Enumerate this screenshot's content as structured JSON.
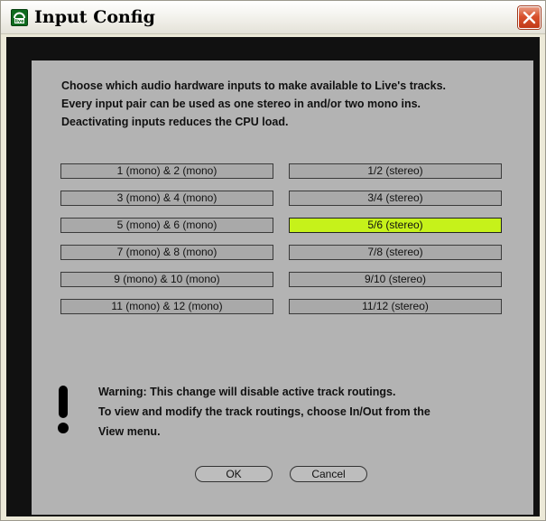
{
  "window": {
    "title": "Input Config",
    "app_icon_text": "live"
  },
  "intro": [
    "Choose which audio hardware inputs to make available to Live's tracks.",
    "Every input pair can be used as one stereo in and/or two mono ins.",
    "Deactivating inputs reduces the CPU load."
  ],
  "mono_inputs": [
    {
      "label": "1 (mono) & 2 (mono)",
      "active": false
    },
    {
      "label": "3 (mono) & 4 (mono)",
      "active": false
    },
    {
      "label": "5 (mono) & 6 (mono)",
      "active": false
    },
    {
      "label": "7 (mono) & 8 (mono)",
      "active": false
    },
    {
      "label": "9 (mono) & 10 (mono)",
      "active": false
    },
    {
      "label": "11 (mono) & 12 (mono)",
      "active": false
    }
  ],
  "stereo_inputs": [
    {
      "label": "1/2 (stereo)",
      "active": false
    },
    {
      "label": "3/4 (stereo)",
      "active": false
    },
    {
      "label": "5/6 (stereo)",
      "active": true
    },
    {
      "label": "7/8 (stereo)",
      "active": false
    },
    {
      "label": "9/10 (stereo)",
      "active": false
    },
    {
      "label": "11/12 (stereo)",
      "active": false
    }
  ],
  "warning": [
    "Warning: This change will disable active track routings.",
    "To view and modify the track routings, choose In/Out from the",
    "View menu."
  ],
  "buttons": {
    "ok": "OK",
    "cancel": "Cancel"
  },
  "colors": {
    "panel": "#b3b3b3",
    "active_button": "#c6f21a",
    "inactive_button": "#a9a9a9",
    "outer_frame": "#111111"
  }
}
